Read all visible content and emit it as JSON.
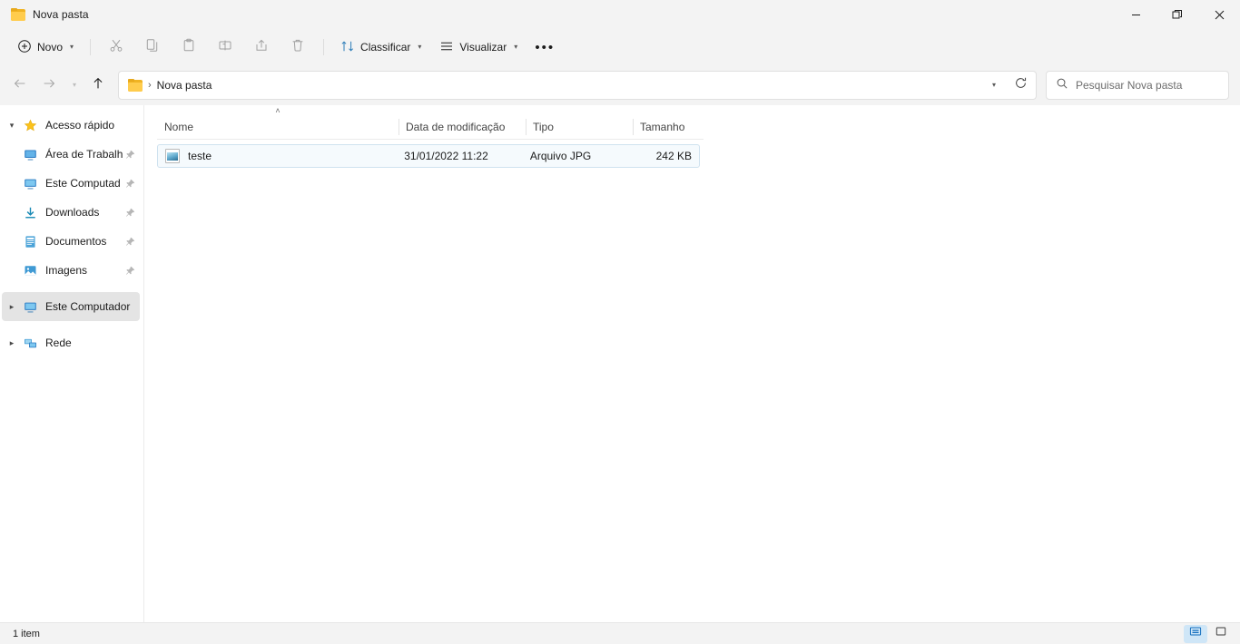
{
  "window": {
    "title": "Nova pasta",
    "icon": "folder-icon",
    "controls": {
      "minimize": "minimize-icon",
      "maximize": "restore-icon",
      "close": "close-icon"
    }
  },
  "toolbar": {
    "new_label": "Novo",
    "new_icon": "plus-circle-icon",
    "actions": [
      {
        "name": "cut-button",
        "icon": "scissors-icon",
        "label": "Recortar",
        "disabled": true
      },
      {
        "name": "copy-button",
        "icon": "copy-icon",
        "label": "Copiar",
        "disabled": true
      },
      {
        "name": "paste-button",
        "icon": "clipboard-icon",
        "label": "Colar",
        "disabled": true
      },
      {
        "name": "rename-button",
        "icon": "rename-icon",
        "label": "Renomear",
        "disabled": true
      },
      {
        "name": "share-button",
        "icon": "share-icon",
        "label": "Compartilhar",
        "disabled": true
      },
      {
        "name": "delete-button",
        "icon": "trash-icon",
        "label": "Excluir",
        "disabled": true
      }
    ],
    "sort_label": "Classificar",
    "sort_icon": "sort-arrows-icon",
    "view_label": "Visualizar",
    "view_icon": "list-lines-icon",
    "more_label": "•••"
  },
  "address": {
    "back_icon": "arrow-left-icon",
    "forward_icon": "arrow-right-icon",
    "recent_icon": "chevron-down-icon",
    "up_icon": "arrow-up-icon",
    "folder_icon": "folder-icon",
    "separator": "›",
    "breadcrumb": "Nova pasta",
    "dropdown_icon": "chevron-down-icon",
    "refresh_icon": "refresh-icon"
  },
  "search": {
    "icon": "search-icon",
    "placeholder": "Pesquisar Nova pasta",
    "value": ""
  },
  "sidebar": {
    "items": [
      {
        "label": "Acesso rápido",
        "icon": "star-icon",
        "twisty": "∨",
        "indent": false,
        "pinned": false,
        "selected": false
      },
      {
        "label": "Área de Trabalh",
        "icon": "desktop-icon",
        "twisty": "",
        "indent": true,
        "pinned": true,
        "selected": false
      },
      {
        "label": "Este Computad",
        "icon": "monitor-icon",
        "twisty": "",
        "indent": true,
        "pinned": true,
        "selected": false
      },
      {
        "label": "Downloads",
        "icon": "download-icon",
        "twisty": "",
        "indent": true,
        "pinned": true,
        "selected": false
      },
      {
        "label": "Documentos",
        "icon": "document-icon",
        "twisty": "",
        "indent": true,
        "pinned": true,
        "selected": false
      },
      {
        "label": "Imagens",
        "icon": "picture-icon",
        "twisty": "",
        "indent": true,
        "pinned": true,
        "selected": false
      },
      {
        "label": "Este Computador",
        "icon": "monitor-icon",
        "twisty": "›",
        "indent": false,
        "pinned": false,
        "selected": true
      },
      {
        "label": "Rede",
        "icon": "network-icon",
        "twisty": "›",
        "indent": false,
        "pinned": false,
        "selected": false
      }
    ]
  },
  "file_list": {
    "columns": [
      {
        "label": "Nome",
        "sort": "asc"
      },
      {
        "label": "Data de modificação",
        "sort": ""
      },
      {
        "label": "Tipo",
        "sort": ""
      },
      {
        "label": "Tamanho",
        "sort": ""
      }
    ],
    "sort_asc_glyph": "˄",
    "rows": [
      {
        "name": "teste",
        "icon": "jpg-file-icon",
        "modified": "31/01/2022 11:22",
        "type": "Arquivo JPG",
        "size": "242 KB",
        "selected": true
      }
    ]
  },
  "statusbar": {
    "item_count": "1 item",
    "views": [
      {
        "name": "details-view-button",
        "icon": "details-view-icon",
        "active": true
      },
      {
        "name": "large-icons-view-button",
        "icon": "large-icons-view-icon",
        "active": false
      }
    ]
  },
  "colors": {
    "chrome": "#f3f3f3",
    "accent": "#0f6cbd",
    "selection_bg": "#f5fafd",
    "selection_border": "#cfe2ef",
    "sidebar_selected": "#e4e4e4",
    "folder_yellow": "#ffcc4d"
  }
}
